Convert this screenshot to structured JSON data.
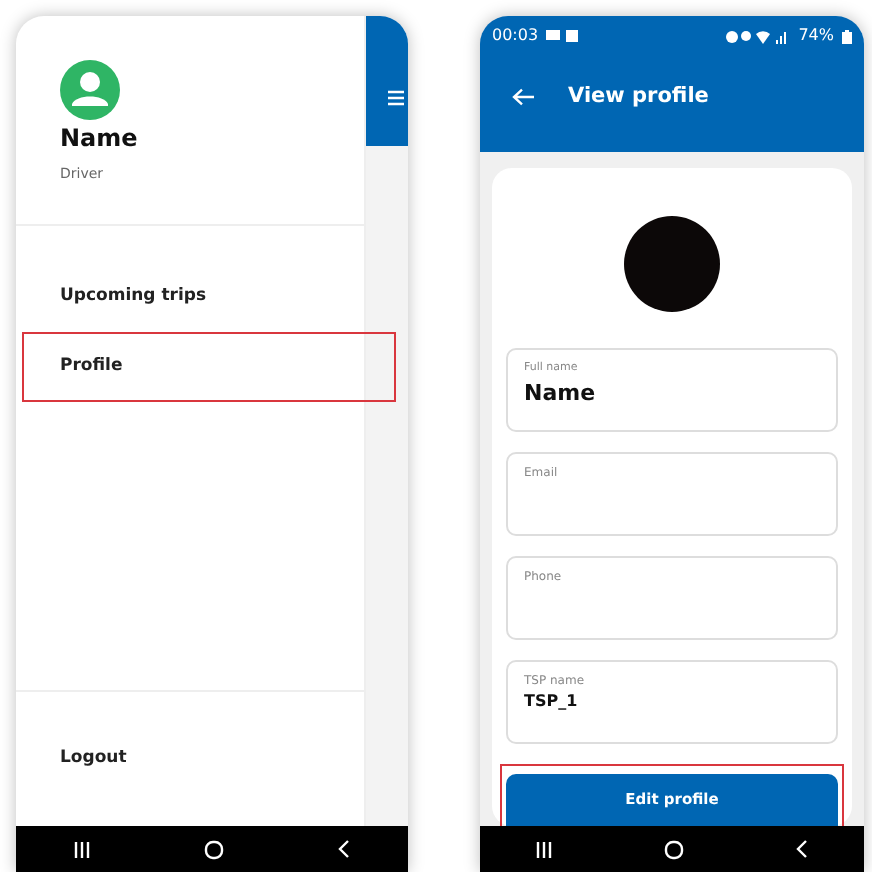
{
  "drawer": {
    "user_name": "Name",
    "role": "Driver",
    "items": [
      {
        "label": "Upcoming trips",
        "highlighted": false
      },
      {
        "label": "Profile",
        "highlighted": true
      }
    ],
    "logout": "Logout"
  },
  "profile_screen": {
    "status_bar": {
      "time": "00:03",
      "battery": "74%"
    },
    "title": "View profile",
    "fields": [
      {
        "label": "Full name",
        "value": "Name",
        "kind": "large"
      },
      {
        "label": "Email",
        "kind": "plain"
      },
      {
        "label": "Phone",
        "kind": "plain"
      },
      {
        "label": "TSP name",
        "value": "TSP_1",
        "kind": "plain"
      }
    ],
    "button": {
      "label": "Edit profile",
      "highlighted": true
    }
  }
}
